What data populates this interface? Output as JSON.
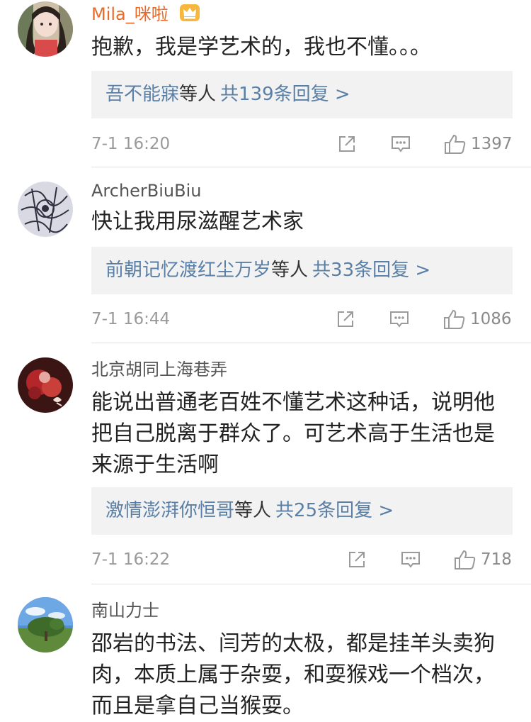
{
  "comments": [
    {
      "username": "Mila_咪啦",
      "text": "抱歉，我是学艺术的，我也不懂。。。",
      "reply_names": "吾不能寐",
      "reply_suffix": "等人",
      "reply_count": "共139条回复 >",
      "time": "7-1 16:20",
      "likes": "1397"
    },
    {
      "username": "ArcherBiuBiu",
      "text": "快让我用尿滋醒艺术家",
      "reply_names": "前朝记忆渡红尘万岁",
      "reply_suffix": "等人",
      "reply_count": "共33条回复 >",
      "time": "7-1 16:44",
      "likes": "1086"
    },
    {
      "username": "北京胡同上海巷弄",
      "text": "能说出普通老百姓不懂艺术这种话，说明他把自己脱离于群众了。可艺术高于生活也是来源于生活啊",
      "reply_names": "激情澎湃你恒哥",
      "reply_suffix": "等人",
      "reply_count": "共25条回复 >",
      "time": "7-1 16:22",
      "likes": "718"
    },
    {
      "username": "南山力士",
      "text": "邵岩的书法、闫芳的太极，都是挂羊头卖狗肉，本质上属于杂耍，和耍猴戏一个档次，而且是拿自己当猴耍。"
    }
  ],
  "icons": {
    "vip_badge": "crown-icon",
    "share": "share-icon",
    "comment": "comment-icon",
    "like": "thumbs-up-icon"
  },
  "colors": {
    "vip_username": "#e86b2a",
    "reply_link": "#5a7fa6",
    "reply_box_bg": "#f2f2f2",
    "meta_gray": "#9a9a9a"
  }
}
